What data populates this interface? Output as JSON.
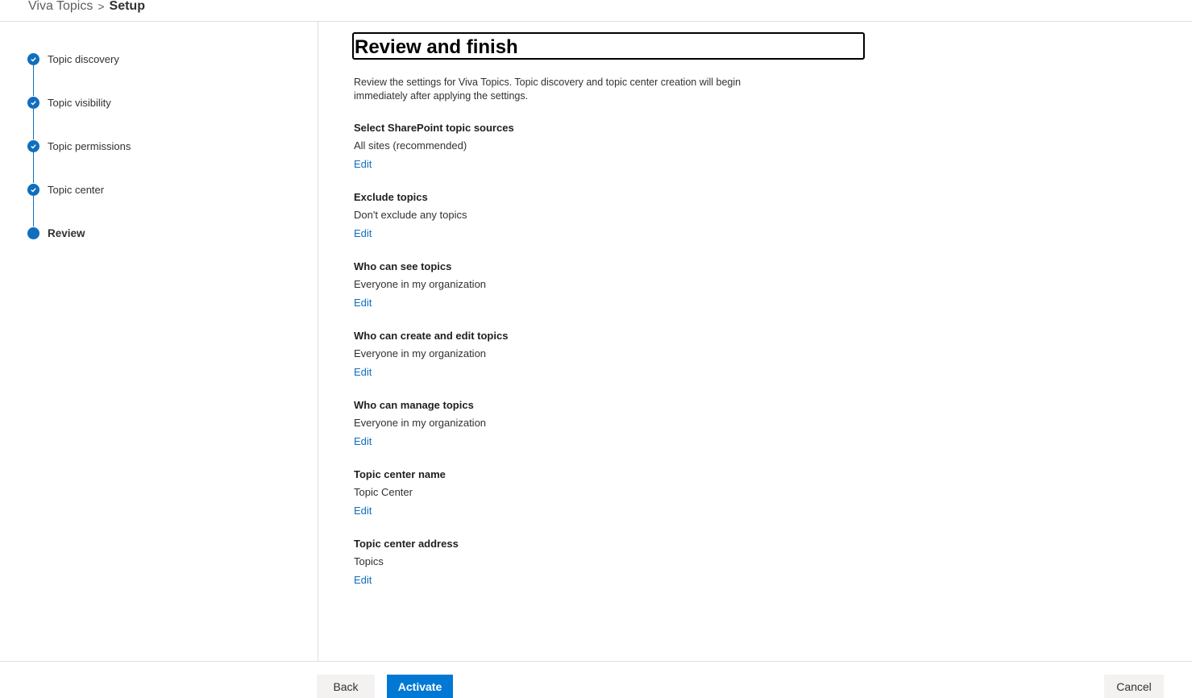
{
  "breadcrumb": {
    "parent": "Viva Topics",
    "separator": ">",
    "current": "Setup"
  },
  "steps": [
    {
      "label": "Topic discovery",
      "status": "complete"
    },
    {
      "label": "Topic visibility",
      "status": "complete"
    },
    {
      "label": "Topic permissions",
      "status": "complete"
    },
    {
      "label": "Topic center",
      "status": "complete"
    },
    {
      "label": "Review",
      "status": "current"
    }
  ],
  "main": {
    "title": "Review and finish",
    "intro": "Review the settings for Viva Topics. Topic discovery and topic center creation will begin immediately after applying the settings.",
    "sections": [
      {
        "heading": "Select SharePoint topic sources",
        "value": "All sites (recommended)",
        "edit": "Edit"
      },
      {
        "heading": "Exclude topics",
        "value": "Don't exclude any topics",
        "edit": "Edit"
      },
      {
        "heading": "Who can see topics",
        "value": "Everyone in my organization",
        "edit": "Edit"
      },
      {
        "heading": "Who can create and edit topics",
        "value": "Everyone in my organization",
        "edit": "Edit"
      },
      {
        "heading": "Who can manage topics",
        "value": "Everyone in my organization",
        "edit": "Edit"
      },
      {
        "heading": "Topic center name",
        "value": "Topic Center",
        "edit": "Edit"
      },
      {
        "heading": "Topic center address",
        "value": "Topics",
        "edit": "Edit"
      }
    ]
  },
  "footer": {
    "back_label": "Back",
    "activate_label": "Activate",
    "cancel_label": "Cancel"
  },
  "colors": {
    "accent": "#0078d4",
    "link": "#106ebe"
  }
}
